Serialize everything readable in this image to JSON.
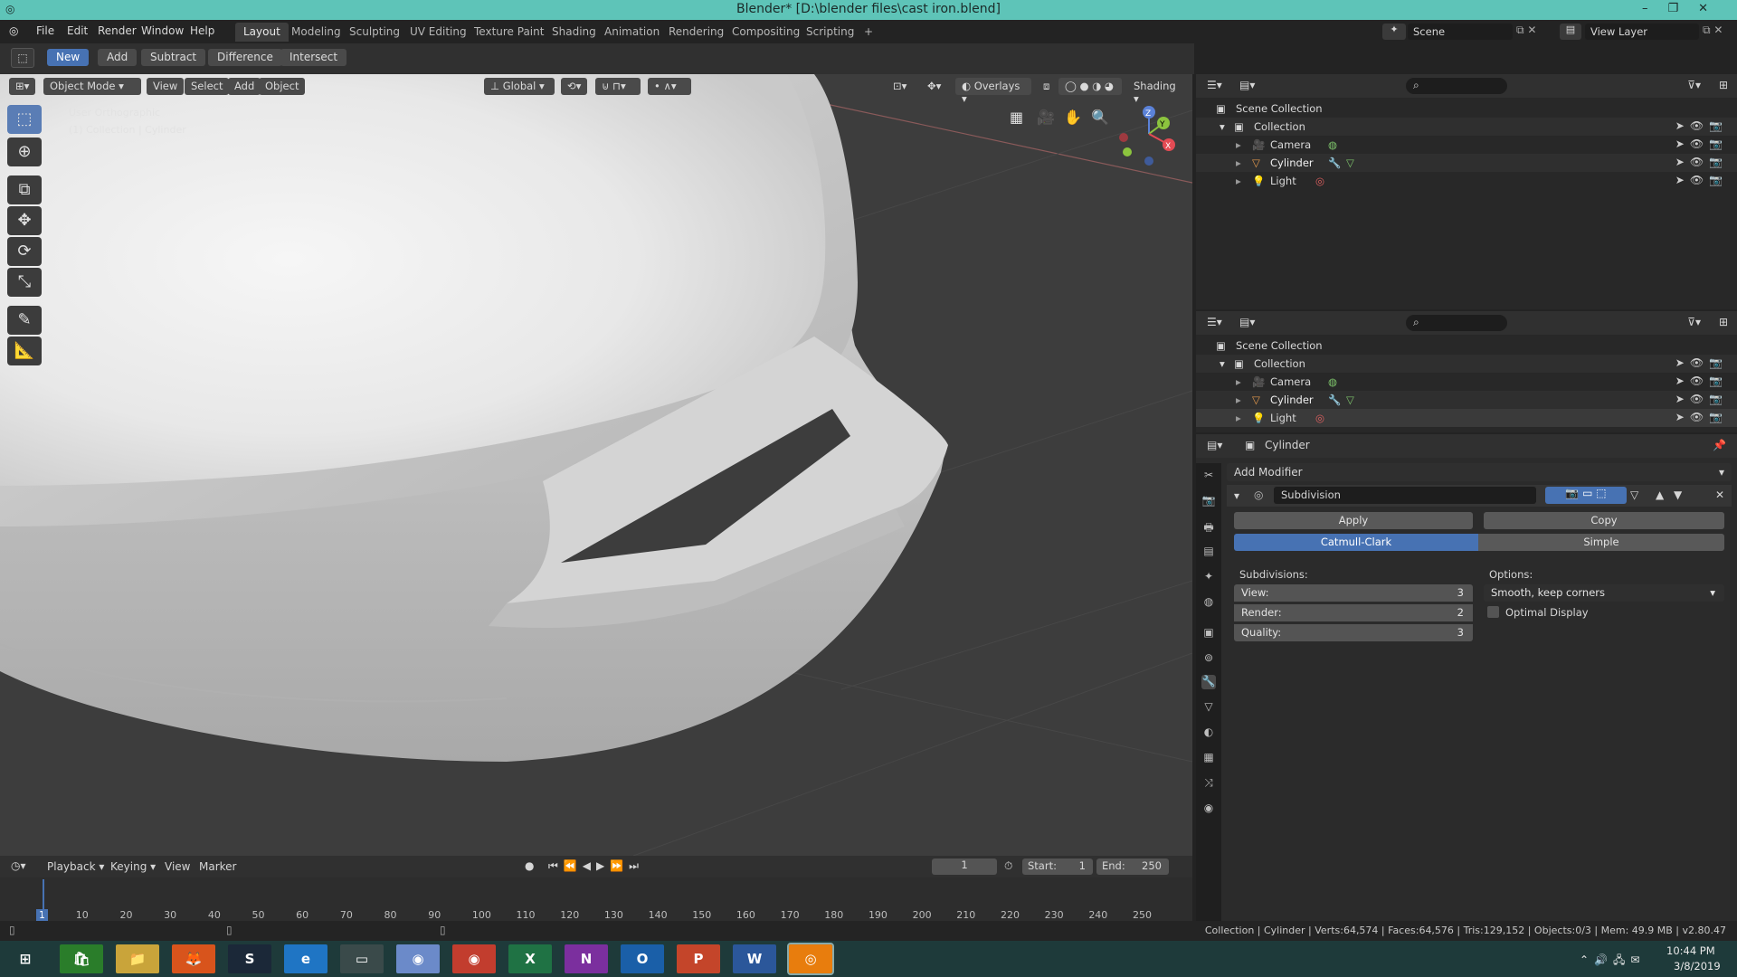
{
  "window": {
    "title": "Blender* [D:\\blender files\\cast iron.blend]",
    "controls": [
      "–",
      "❐",
      "✕"
    ]
  },
  "menu": {
    "items": [
      "File",
      "Edit",
      "Render",
      "Window",
      "Help"
    ]
  },
  "workspaces": [
    "Layout",
    "Modeling",
    "Sculpting",
    "UV Editing",
    "Texture Paint",
    "Shading",
    "Animation",
    "Rendering",
    "Compositing",
    "Scripting",
    "+"
  ],
  "scene": {
    "name": "Scene",
    "view_layer": "View Layer"
  },
  "toolheader": {
    "buttons": [
      "New",
      "Add",
      "Subtract",
      "Difference",
      "Intersect"
    ]
  },
  "viewport": {
    "mode": "Object Mode",
    "menus": [
      "View",
      "Select",
      "Add",
      "Object"
    ],
    "orientation": "Global",
    "overlays": "Overlays",
    "shading": "Shading",
    "view_name": "User Orthographic",
    "context": "(1) Collection | Cylinder",
    "gizmo": {
      "z": "Z",
      "y": "Y",
      "x": "X"
    }
  },
  "outliner_top": {
    "root": "Scene Collection",
    "collection": "Collection",
    "items": [
      "Camera",
      "Cylinder",
      "Light"
    ]
  },
  "outliner_bottom": {
    "root": "Scene Collection",
    "collection": "Collection",
    "items": [
      "Camera",
      "Cylinder",
      "Light"
    ]
  },
  "properties": {
    "object_name": "Cylinder",
    "add_modifier": "Add Modifier",
    "modifier_name": "Subdivision",
    "apply": "Apply",
    "copy": "Copy",
    "algo_active": "Catmull-Clark",
    "algo_other": "Simple",
    "subdivisions_label": "Subdivisions:",
    "options_label": "Options:",
    "view_label": "View:",
    "view_value": "3",
    "render_label": "Render:",
    "render_value": "2",
    "quality_label": "Quality:",
    "quality_value": "3",
    "uv_smooth": "Smooth, keep corners",
    "optimal_display": "Optimal Display"
  },
  "timeline": {
    "menus": [
      "Playback",
      "Keying",
      "View",
      "Marker"
    ],
    "current_frame": "1",
    "start_label": "Start:",
    "start": "1",
    "end_label": "End:",
    "end": "250",
    "ticks": [
      "1",
      "10",
      "20",
      "30",
      "40",
      "50",
      "60",
      "70",
      "80",
      "90",
      "100",
      "110",
      "120",
      "130",
      "140",
      "150",
      "160",
      "170",
      "180",
      "190",
      "200",
      "210",
      "220",
      "230",
      "240",
      "250"
    ]
  },
  "status": "Collection | Cylinder | Verts:64,574 | Faces:64,576 | Tris:129,152 | Objects:0/3 | Mem: 49.9 MB | v2.80.47",
  "taskbar": {
    "time": "10:44 PM",
    "date": "3/8/2019",
    "apps": [
      {
        "name": "start-icon",
        "glyph": "⊞",
        "color": "#1e3a3a"
      },
      {
        "name": "store-icon",
        "glyph": "🛍",
        "color": "#2a7d2a"
      },
      {
        "name": "file-explorer-icon",
        "glyph": "📁",
        "color": "#c9a43a"
      },
      {
        "name": "firefox-icon",
        "glyph": "🦊",
        "color": "#d8541c"
      },
      {
        "name": "steam-icon",
        "glyph": "S",
        "color": "#1b2838"
      },
      {
        "name": "edge-icon",
        "glyph": "e",
        "color": "#1f75c4"
      },
      {
        "name": "window-icon",
        "glyph": "▭",
        "color": "#3a4a4a"
      },
      {
        "name": "chrome-canary-icon",
        "glyph": "◉",
        "color": "#6b8ac9"
      },
      {
        "name": "chrome-icon",
        "glyph": "◉",
        "color": "#c23d2e"
      },
      {
        "name": "excel-icon",
        "glyph": "X",
        "color": "#1f7244"
      },
      {
        "name": "onenote-icon",
        "glyph": "N",
        "color": "#7b2f9e"
      },
      {
        "name": "outlook-icon",
        "glyph": "O",
        "color": "#1a5fa8"
      },
      {
        "name": "powerpoint-icon",
        "glyph": "P",
        "color": "#c4452a"
      },
      {
        "name": "word-icon",
        "glyph": "W",
        "color": "#2b579a"
      },
      {
        "name": "blender-icon",
        "glyph": "◎",
        "color": "#e87d0d"
      }
    ]
  },
  "colors": {
    "accent": "#4772b3",
    "titlebar": "#5ec4b8"
  }
}
